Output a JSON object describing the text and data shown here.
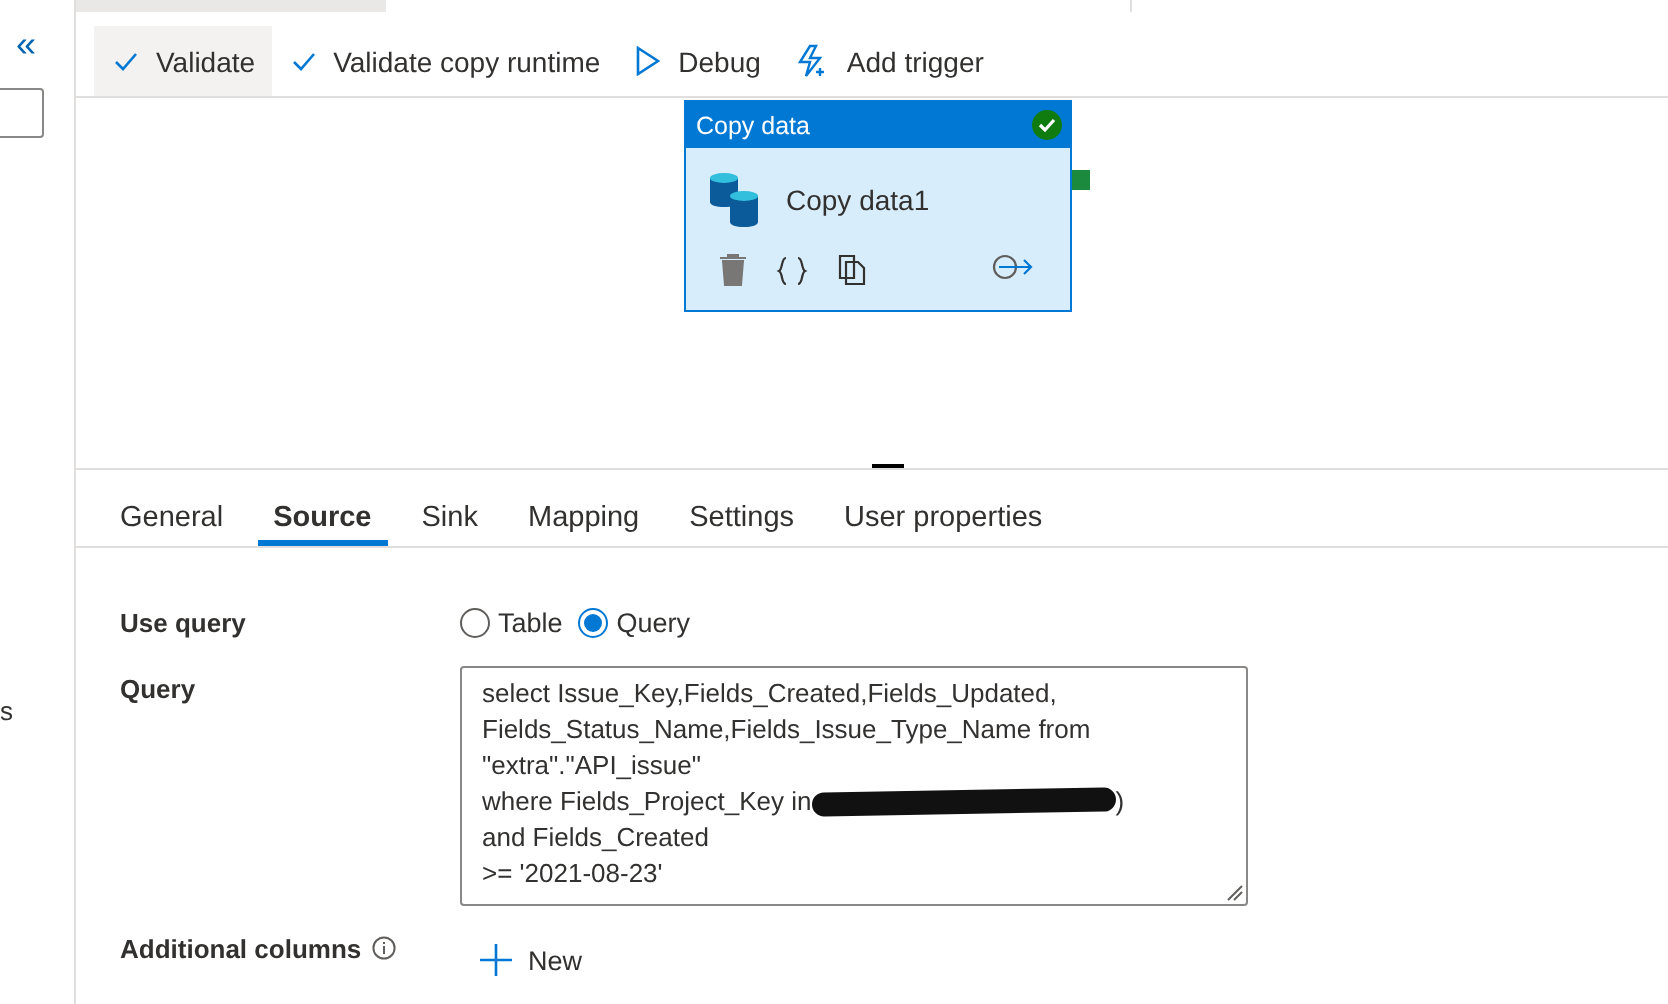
{
  "sidebar": {
    "collapse_glyph": "«",
    "fragment": "s"
  },
  "toolbar": [
    {
      "label": "Validate",
      "kind": "check",
      "highlighted": true
    },
    {
      "label": "Validate copy runtime",
      "kind": "check",
      "highlighted": false
    },
    {
      "label": "Debug",
      "kind": "run",
      "highlighted": false
    },
    {
      "label": "Add trigger",
      "kind": "trigger",
      "highlighted": false
    }
  ],
  "activity": {
    "type_label": "Copy data",
    "name": "Copy data1",
    "succeeded": true
  },
  "tabs": [
    {
      "label": "General",
      "selected": false
    },
    {
      "label": "Source",
      "selected": true
    },
    {
      "label": "Sink",
      "selected": false
    },
    {
      "label": "Mapping",
      "selected": false
    },
    {
      "label": "Settings",
      "selected": false
    },
    {
      "label": "User properties",
      "selected": false
    }
  ],
  "form": {
    "use_query": {
      "label": "Use query",
      "options": [
        {
          "label": "Table",
          "selected": false
        },
        {
          "label": "Query",
          "selected": true
        }
      ]
    },
    "query": {
      "label": "Query",
      "lines": [
        {
          "text": "select Issue_Key,Fields_Created,Fields_Updated,",
          "redacted": false
        },
        {
          "text": "Fields_Status_Name,Fields_Issue_Type_Name from",
          "redacted": false
        },
        {
          "text": "\"extra\".\"API_issue\"",
          "redacted": false
        },
        {
          "text": "where Fields_Project_Key in",
          "redacted": true,
          "tail": ")"
        },
        {
          "text": "and Fields_Created",
          "redacted": false
        },
        {
          "text": ">= '2021-08-23'",
          "redacted": false
        }
      ]
    },
    "additional_columns": {
      "label": "Additional columns",
      "button": "New"
    }
  }
}
